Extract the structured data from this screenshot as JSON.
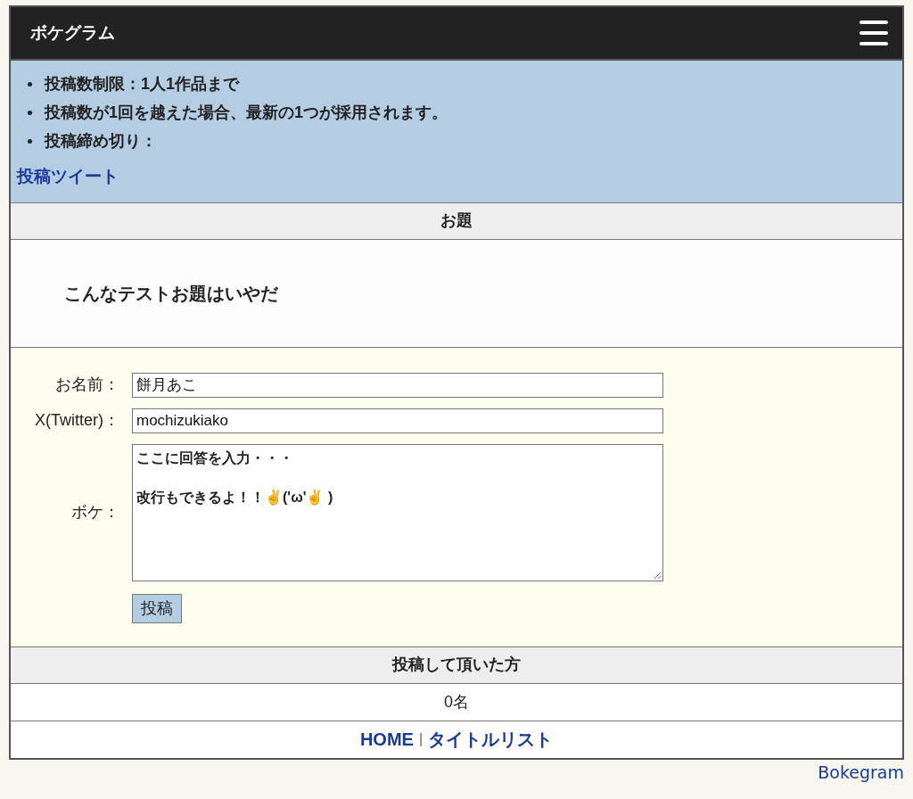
{
  "header": {
    "title": "ボケグラム"
  },
  "notes": {
    "items": [
      "投稿数制限：1人1作品まで",
      "投稿数が1回を越えた場合、最新の1つが採用されます。",
      "投稿締め切り："
    ],
    "link": "投稿ツイート"
  },
  "topic": {
    "heading": "お題",
    "text": "こんなテストお題はいやだ"
  },
  "form": {
    "fields": [
      {
        "kind": "input",
        "label": "お名前：",
        "value": "餅月あこ"
      },
      {
        "kind": "input",
        "label": "X(Twitter)：",
        "value": "mochizukiako"
      },
      {
        "kind": "textarea",
        "label": "ボケ：",
        "lines": [
          "ここに回答を入力・・・",
          "改行もできるよ！！✌('ω'✌ )"
        ]
      }
    ],
    "submit": "投稿"
  },
  "entrants": {
    "heading": "投稿して頂いた方",
    "count": "0名"
  },
  "footer_links": {
    "links": [
      "HOME",
      "タイトルリスト"
    ],
    "separator": "|"
  },
  "credit": "Bokegram"
}
